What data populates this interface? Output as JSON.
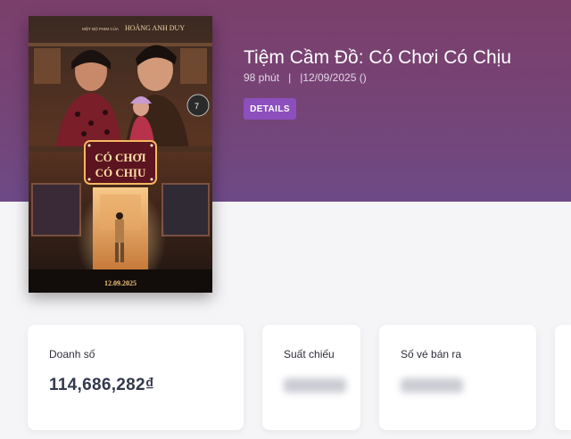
{
  "movie": {
    "title": "Tiệm Cầm Đồ: Có Chơi Có Chịu",
    "duration": "98 phút",
    "separator": "|",
    "release_date": "|12/09/2025 ()",
    "details_label": "DETAILS"
  },
  "poster": {
    "top_credit": "MỘT BỘ PHIM CỦA",
    "director": "HOÀNG ANH DUY",
    "logo_line1": "CÓ CHƠI",
    "logo_line2": "CÓ CHỊU",
    "date": "12.09.2025",
    "badge": "7"
  },
  "stats": {
    "revenue_label": "Doanh số",
    "revenue_value": "114,686,282₫",
    "showtimes_label": "Suất chiếu",
    "tickets_label": "Số vé bán ra"
  },
  "colors": {
    "accent": "#8c4fbd",
    "hero_top": "#7b3f6b",
    "hero_bottom": "#6e4a86"
  }
}
